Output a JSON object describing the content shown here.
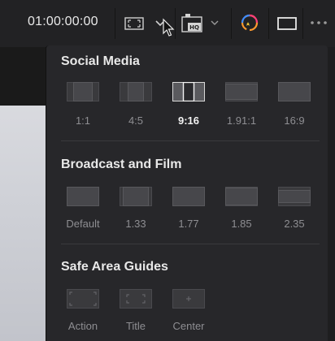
{
  "toolbar": {
    "timecode": "01:00:00:00",
    "buttons": [
      {
        "name": "frame-aspect-icon"
      },
      {
        "name": "chevron-down-icon"
      },
      {
        "name": "hq-playback-icon"
      },
      {
        "name": "color-icon"
      },
      {
        "name": "viewer-mode-icon"
      },
      {
        "name": "more-options-icon"
      }
    ]
  },
  "sections": {
    "social": {
      "title": "Social Media",
      "options": [
        {
          "label": "1:1",
          "selected": false
        },
        {
          "label": "4:5",
          "selected": false
        },
        {
          "label": "9:16",
          "selected": true
        },
        {
          "label": "1.91:1",
          "selected": false
        },
        {
          "label": "16:9",
          "selected": false
        }
      ]
    },
    "broadcast": {
      "title": "Broadcast and Film",
      "options": [
        {
          "label": "Default"
        },
        {
          "label": "1.33"
        },
        {
          "label": "1.77"
        },
        {
          "label": "1.85"
        },
        {
          "label": "2.35"
        }
      ]
    },
    "safe": {
      "title": "Safe Area Guides",
      "options": [
        {
          "label": "Action"
        },
        {
          "label": "Title"
        },
        {
          "label": "Center"
        }
      ]
    }
  },
  "colors": {
    "panel_bg": "#27272a",
    "toolbar_bg": "#222224",
    "label_muted": "#8e8e92",
    "label_selected": "#f2f2f2"
  }
}
